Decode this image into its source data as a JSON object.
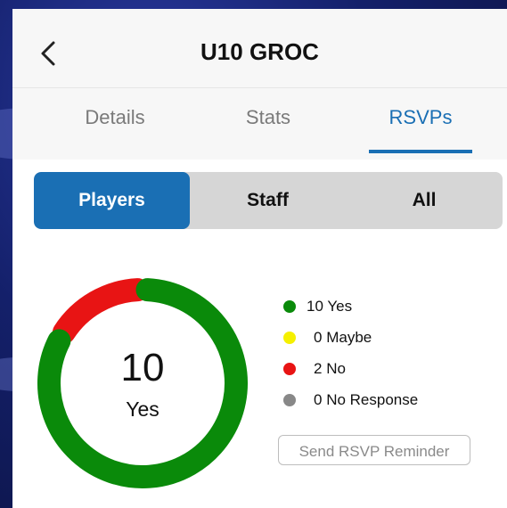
{
  "header": {
    "title": "U10 GROC",
    "back_icon": "chevron-left-icon"
  },
  "tabs": [
    {
      "label": "Details",
      "active": false
    },
    {
      "label": "Stats",
      "active": false
    },
    {
      "label": "RSVPs",
      "active": true
    }
  ],
  "segments": [
    {
      "label": "Players",
      "active": true
    },
    {
      "label": "Staff",
      "active": false
    },
    {
      "label": "All",
      "active": false
    }
  ],
  "summary": {
    "count": "10",
    "label": "Yes"
  },
  "legend": [
    {
      "count": "10",
      "label": "Yes",
      "color": "#0a8a0a"
    },
    {
      "count": "0",
      "label": "Maybe",
      "color": "#f5f000"
    },
    {
      "count": "2",
      "label": "No",
      "color": "#e81414"
    },
    {
      "count": "0",
      "label": "No Response",
      "color": "#888888"
    }
  ],
  "chart_data": {
    "type": "pie",
    "categories": [
      "Yes",
      "Maybe",
      "No",
      "No Response"
    ],
    "values": [
      10,
      0,
      2,
      0
    ],
    "colors": [
      "#0a8a0a",
      "#f5f000",
      "#e81414",
      "#888888"
    ]
  },
  "actions": {
    "reminder_label": "Send RSVP Reminder"
  },
  "colors": {
    "accent": "#1a6fb4",
    "yes": "#0a8a0a",
    "no": "#e81414"
  }
}
